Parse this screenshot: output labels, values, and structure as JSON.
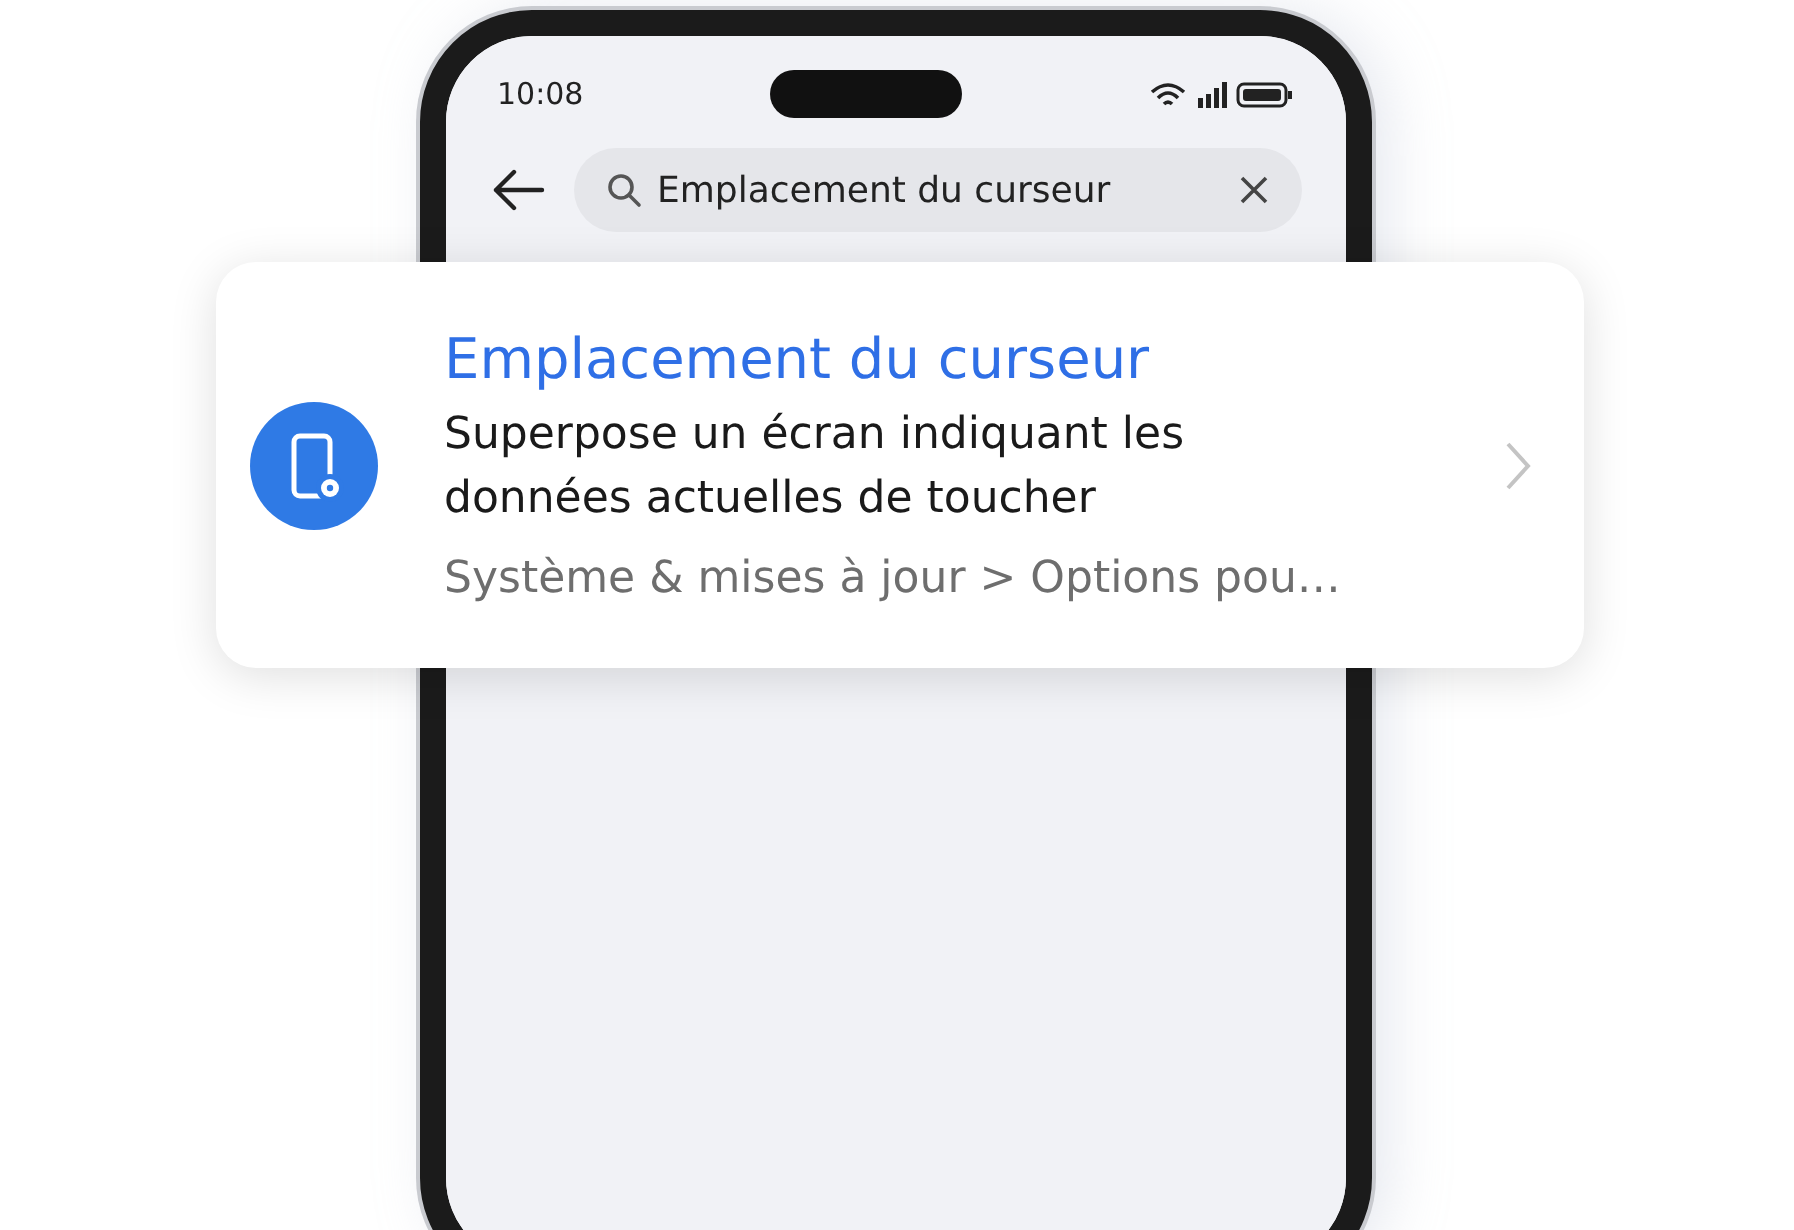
{
  "status_bar": {
    "time": "10:08"
  },
  "search": {
    "value": "Emplacement du curseur"
  },
  "result": {
    "title": "Emplacement du curseur",
    "description": "Superpose un écran indiquant les données actuelles de toucher",
    "path": "Système & mises à jour > Options pou…"
  }
}
